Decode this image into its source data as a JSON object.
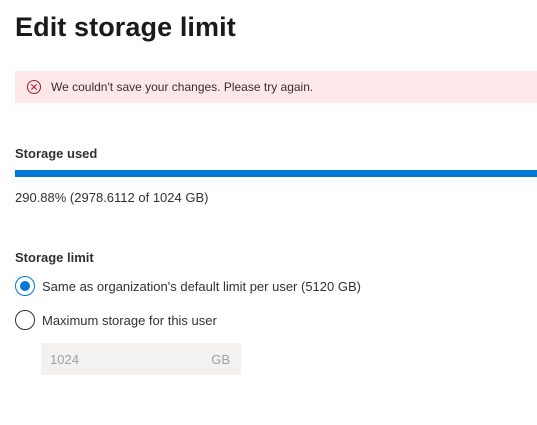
{
  "page": {
    "title": "Edit storage limit"
  },
  "error": {
    "icon": "error-circle-icon",
    "message": "We couldn't save your changes. Please try again.",
    "color": "#a4262c",
    "background": "#fde7e9"
  },
  "storage_used": {
    "label": "Storage used",
    "usage_text": "290.88% (2978.6112 of 1024 GB)",
    "progress_fraction": 1.0,
    "bar_color": "#0078d4"
  },
  "storage_limit": {
    "label": "Storage limit",
    "options": [
      {
        "label": "Same as organization's default limit per user (5120 GB)",
        "selected": true
      },
      {
        "label": "Maximum storage for this user",
        "selected": false
      }
    ],
    "custom_value": "1024",
    "unit": "GB"
  }
}
